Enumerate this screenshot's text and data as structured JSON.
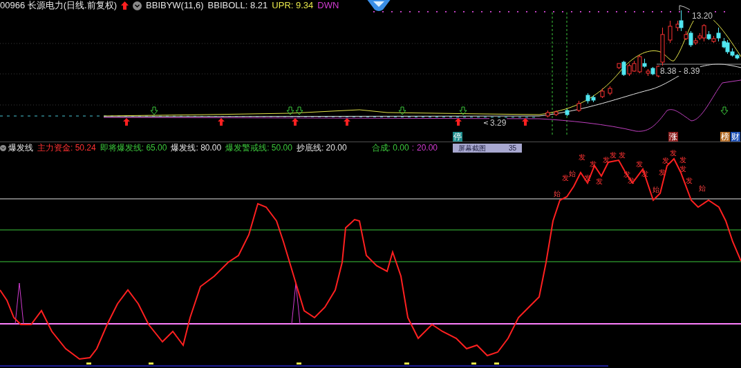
{
  "header": {
    "title": "00966 长源电力(日线.前复权)",
    "indicator": "BBIBYW(11,6)",
    "values": [
      {
        "text": "BBIBOLL: 8.21",
        "color": "#e6e6e6"
      },
      {
        "text": "UPR: 9.34",
        "color": "#e6e64a"
      },
      {
        "text": "DWN",
        "color": "#d23cd2"
      }
    ]
  },
  "price_chart": {
    "labels": [
      {
        "kind": "high",
        "text": "13.20"
      },
      {
        "kind": "range",
        "text": "8.38 - 8.39"
      },
      {
        "kind": "low",
        "text": "3.29"
      }
    ],
    "badges": [
      {
        "kind": "stop",
        "text": "停"
      },
      {
        "kind": "rise",
        "text": "涨"
      },
      {
        "kind": "rank",
        "text": "榜"
      },
      {
        "kind": "finance",
        "text": "财"
      }
    ]
  },
  "indicator_panel": {
    "name": "爆发线",
    "legend": [
      {
        "label": "主力资金:",
        "value": "50.24",
        "color": "#ff3232"
      },
      {
        "label": "即将爆发线:",
        "value": "65.00",
        "color": "#3cc83c"
      },
      {
        "label": "爆发线:",
        "value": "80.00",
        "color": "#e6e6e6"
      },
      {
        "label": "爆发警戒线:",
        "value": "50.00",
        "color": "#3cc83c"
      },
      {
        "label": "抄底线:",
        "value": "20.00",
        "color": "#e6e6e6"
      }
    ],
    "composite": {
      "label": "合成:",
      "value_1": "0.00",
      "separator": ":",
      "value_2": "20.00"
    },
    "screenshot_button": {
      "label": "屏幕截图",
      "count": "35"
    },
    "signal_marks": [
      {
        "kind": "burst",
        "text": "发"
      },
      {
        "kind": "burst",
        "text": "发"
      },
      {
        "kind": "burst",
        "text": "发"
      },
      {
        "kind": "burst",
        "text": "发"
      },
      {
        "kind": "burst",
        "text": "发"
      },
      {
        "kind": "burst",
        "text": "发"
      },
      {
        "kind": "burst",
        "text": "发"
      },
      {
        "kind": "burst",
        "text": "发"
      },
      {
        "kind": "burst",
        "text": "发"
      },
      {
        "kind": "burst",
        "text": "发"
      },
      {
        "kind": "burst",
        "text": "发"
      },
      {
        "kind": "burst",
        "text": "发"
      },
      {
        "kind": "burst",
        "text": "发"
      },
      {
        "kind": "burst",
        "text": "发"
      },
      {
        "kind": "burst",
        "text": "发"
      },
      {
        "kind": "burst",
        "text": "发"
      },
      {
        "kind": "burst",
        "text": "发"
      },
      {
        "kind": "burst",
        "text": "发"
      },
      {
        "kind": "start",
        "text": "始"
      },
      {
        "kind": "start",
        "text": "始"
      },
      {
        "kind": "start",
        "text": "始"
      },
      {
        "kind": "start",
        "text": "始"
      }
    ]
  }
}
